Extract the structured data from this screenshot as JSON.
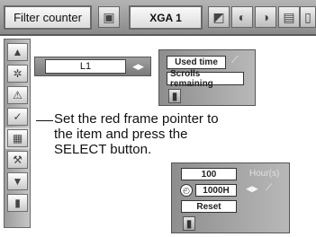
{
  "toolbar": {
    "title": "Filter counter",
    "mode": "XGA 1",
    "icons": [
      "input-icon",
      "screen-icon",
      "image-select-icon",
      "image-adjust-icon",
      "setting-icon",
      "info-icon",
      "pc-adjust-icon"
    ]
  },
  "sidebar": {
    "items": [
      {
        "icon": "triangle-up-icon",
        "glyph": "▲"
      },
      {
        "icon": "fan-icon",
        "glyph": "✲"
      },
      {
        "icon": "warning-icon",
        "glyph": "⚠"
      },
      {
        "icon": "check-icon",
        "glyph": "✓"
      },
      {
        "icon": "filter-icon",
        "glyph": "▦"
      },
      {
        "icon": "wrench-icon",
        "glyph": "⚒"
      },
      {
        "icon": "triangle-down-icon",
        "glyph": "▼"
      },
      {
        "icon": "exit-icon",
        "glyph": "▮"
      }
    ]
  },
  "l1_row": {
    "value": "L1",
    "arrows": "◀▶"
  },
  "filter_panel": {
    "used_time_label": "Used time",
    "used_time_arrow": "⟋",
    "scrolls_label": "Scrolls remaining"
  },
  "instruction": {
    "text": "Set the red frame pointer to the item and press the SELECT button."
  },
  "timer_panel": {
    "hours_value": "100",
    "hours_unit": "Hour(s)",
    "timer_value": "1000H",
    "timer_arrows": "◀▶",
    "timer_dash": "⟋",
    "reset_label": "Reset"
  },
  "colors": {
    "toolbar": "#9c9c9c",
    "panel": "#a0a0a0",
    "field": "#ffffff"
  }
}
